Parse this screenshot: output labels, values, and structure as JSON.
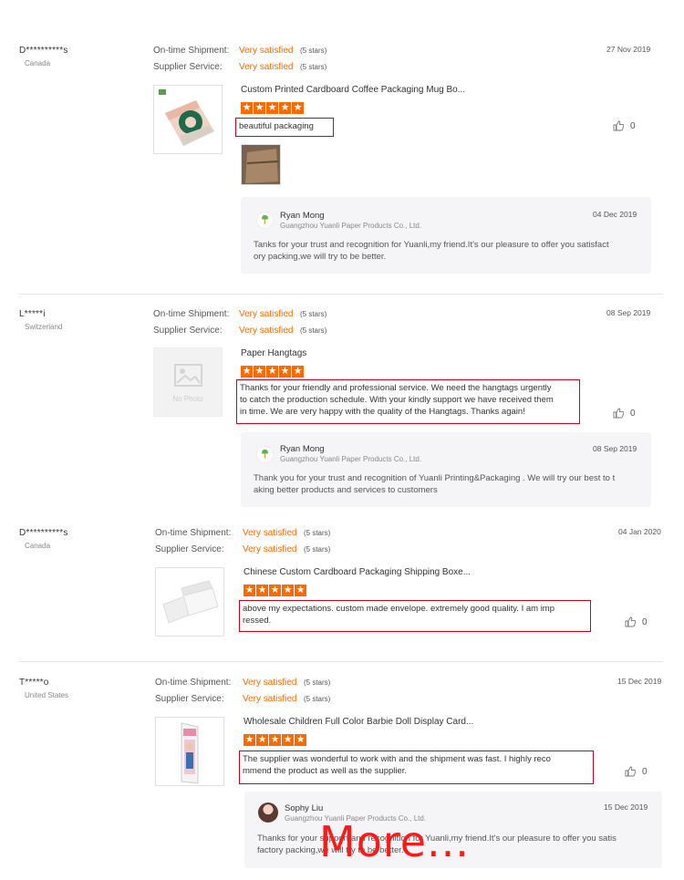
{
  "labels": {
    "shipment": "On-time Shipment:",
    "service": "Supplier Service:",
    "very_satisfied": "Very satisfied",
    "five_stars": "(5 stars)"
  },
  "reviews": [
    {
      "buyer": "D**********s",
      "country": "Canada",
      "date": "27 Nov 2019",
      "product": "Custom Printed Cardboard Coffee Packaging Mug Bo...",
      "comment": "beautiful packaging",
      "likes": "0",
      "reply": {
        "name": "Ryan Mong",
        "company": "Guangzhou Yuanli Paper Products Co., Ltd.",
        "date": "04 Dec 2019",
        "text": [
          "Tanks for your trust and recognition for Yuanli,my friend.It's our pleasure to offer you satisfact",
          "ory packing,we will try to be better."
        ]
      }
    },
    {
      "buyer": "L*****i",
      "country": "Switzerland",
      "date": "08 Sep 2019",
      "product": "Paper Hangtags",
      "no_photo": "No Photo",
      "comment": [
        "Thanks for your friendly and professional service. We need the hangtags urgently",
        "to catch the production schedule. With your kindly support we have received them",
        "in time. We are very happy with the quality of the Hangtags. Thanks again!"
      ],
      "likes": "0",
      "reply": {
        "name": "Ryan Mong",
        "company": "Guangzhou Yuanli Paper Products Co., Ltd.",
        "date": "08 Sep 2019",
        "text": [
          "Thank you for your trust and recognition of Yuanli Printing&Packaging . We will try our best to t",
          "aking better products and services to customers"
        ]
      }
    },
    {
      "buyer": "D**********s",
      "country": "Canada",
      "date": "04 Jan 2020",
      "product": "Chinese Custom Cardboard Packaging Shipping Boxe...",
      "comment": [
        "above my expectations. custom made envelope. extremely good quality. I am imp",
        "ressed."
      ],
      "likes": "0"
    },
    {
      "buyer": "T*****o",
      "country": "United States",
      "date": "15 Dec 2019",
      "product": "Wholesale Children Full Color Barbie Doll Display Card...",
      "comment": [
        "The supplier was wonderful to work with and the shipment was fast. I highly reco",
        "mmend the product as well as the supplier."
      ],
      "likes": "0",
      "reply": {
        "name": "Sophy Liu",
        "company": "Guangzhou Yuanli Paper Products Co., Ltd.",
        "date": "15 Dec 2019",
        "text": [
          "Thanks for your support and recognition for Yuanli,my friend.It's our pleasure to offer you satis",
          "factory packing,we will try to be better."
        ]
      }
    }
  ],
  "overlay": {
    "more": "More..."
  },
  "colors": {
    "accent": "#ff6a00",
    "highlight_border": "#d0021b",
    "more_text": "#ff1a1a"
  },
  "icons": {
    "star": "star-icon",
    "like": "thumbs-up-icon",
    "logo": "company-logo-icon"
  }
}
